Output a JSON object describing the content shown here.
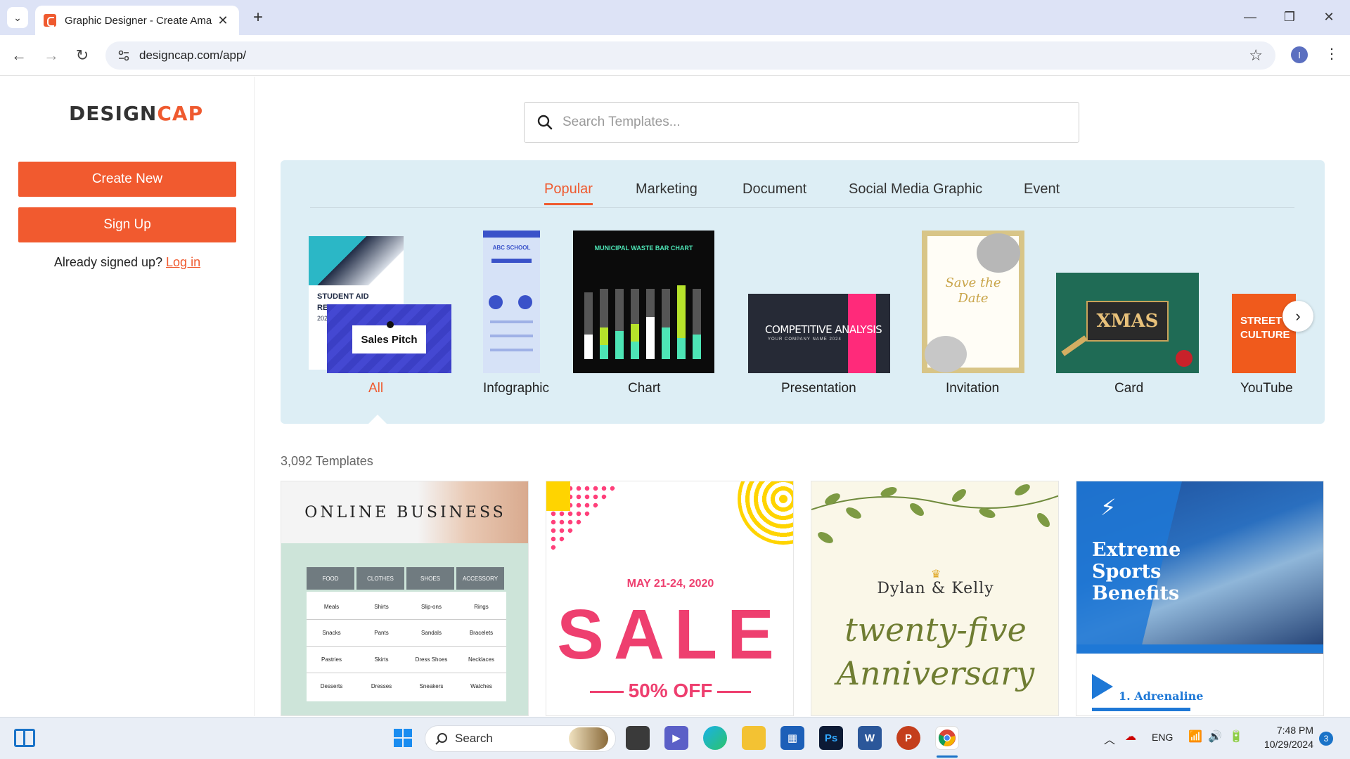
{
  "browser": {
    "tab_title": "Graphic Designer - Create Ama",
    "url": "designcap.com/app/",
    "profile_initial": "I"
  },
  "sidebar": {
    "logo_part1": "DESIGN",
    "logo_part2": "CAP",
    "create_new_label": "Create New",
    "sign_up_label": "Sign Up",
    "signed_up_text": "Already signed up?",
    "log_in_label": "Log in"
  },
  "search": {
    "placeholder": "Search Templates..."
  },
  "categories": {
    "tabs": [
      "Popular",
      "Marketing",
      "Document",
      "Social Media Graphic",
      "Event"
    ],
    "active_tab": "Popular",
    "items": [
      "All",
      "Infographic",
      "Chart",
      "Presentation",
      "Invitation",
      "Card",
      "YouTube"
    ],
    "active_item": "All"
  },
  "thumbs": {
    "all_text1": "STUDENT AID",
    "all_text2": "RE",
    "all_text3": "202",
    "sales_pitch": "Sales Pitch",
    "infographic_title": "ABC SCHOOL",
    "chart_title": "MUNICIPAL WASTE BAR CHART",
    "presentation_title": "COMPETITIVE ANALYSIS",
    "presentation_sub": "YOUR COMPANY NAME 2024",
    "invitation_line1": "Save the",
    "invitation_line2": "Date",
    "card_text": "XMAS",
    "youtube_text1": "STREET",
    "youtube_text2": "CULTURE"
  },
  "templates": {
    "count_label": "3,092 Templates",
    "online_business": {
      "title": "ONLINE BUSINESS",
      "headers": [
        "FOOD",
        "CLOTHES",
        "SHOES",
        "ACCESSORY"
      ],
      "rows": [
        [
          "Meals",
          "Shirts",
          "Slip-ons",
          "Rings"
        ],
        [
          "Snacks",
          "Pants",
          "Sandals",
          "Bracelets"
        ],
        [
          "Pastries",
          "Skirts",
          "Dress Shoes",
          "Necklaces"
        ],
        [
          "Desserts",
          "Dresses",
          "Sneakers",
          "Watches"
        ]
      ]
    },
    "sale": {
      "date": "MAY 21-24, 2020",
      "big": "SALE",
      "off": "50% OFF"
    },
    "anniversary": {
      "names": "Dylan & Kelly",
      "line1": "twenty-five",
      "line2": "Anniversary"
    },
    "sports": {
      "line1": "Extreme",
      "line2": "Sports",
      "line3": "Benefits",
      "item": "1. Adrenaline"
    }
  },
  "taskbar": {
    "search_label": "Search",
    "lang": "ENG",
    "time": "7:48 PM",
    "date": "10/29/2024",
    "notif_count": "3"
  },
  "colors": {
    "brand_orange": "#f15a2f",
    "panel_blue": "#ddeef5"
  }
}
